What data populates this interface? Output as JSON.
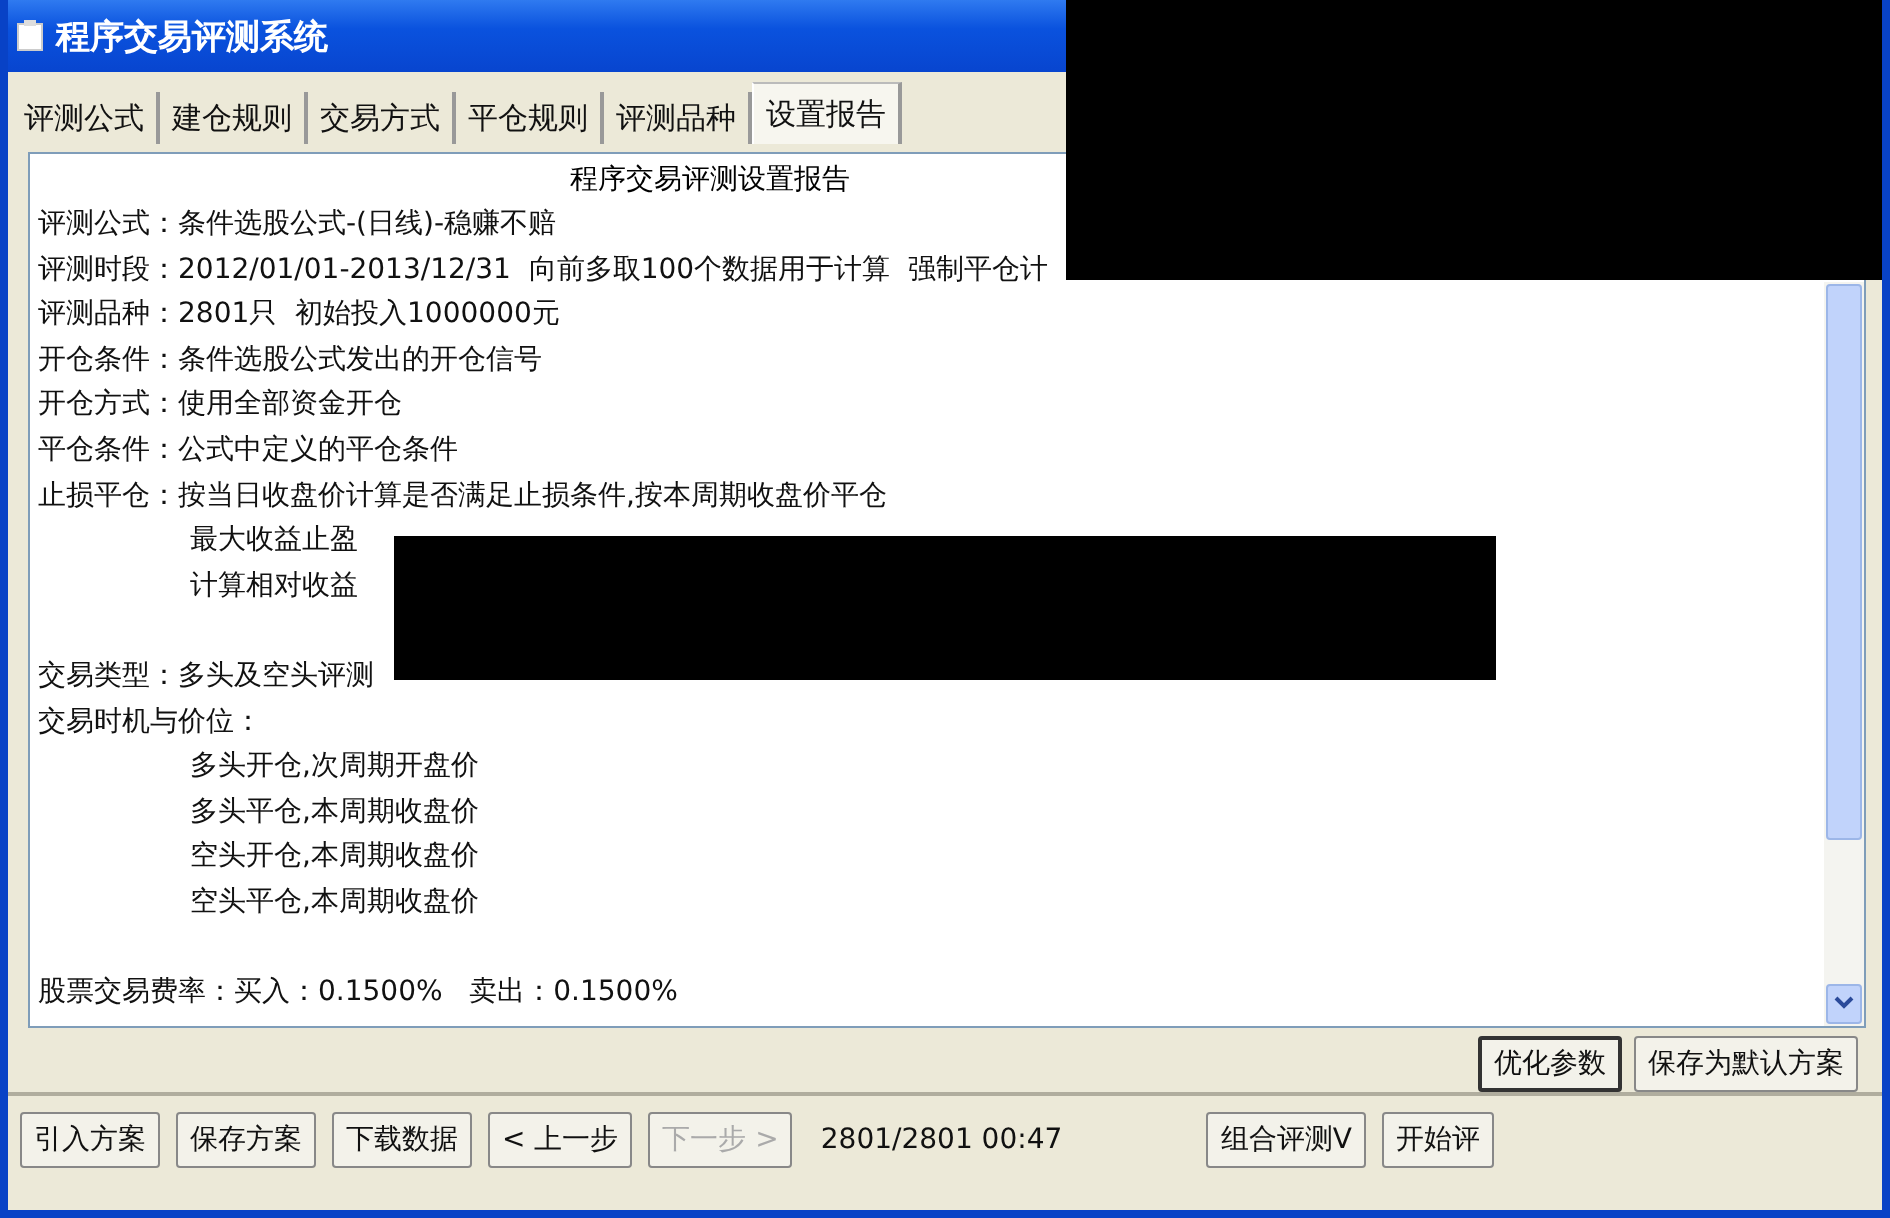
{
  "window": {
    "title": "程序交易评测系统"
  },
  "tabs": [
    {
      "label": "评测公式",
      "selected": false
    },
    {
      "label": "建仓规则",
      "selected": false
    },
    {
      "label": "交易方式",
      "selected": false
    },
    {
      "label": "平仓规则",
      "selected": false
    },
    {
      "label": "评测品种",
      "selected": false
    },
    {
      "label": "设置报告",
      "selected": true
    }
  ],
  "report": {
    "title": "程序交易评测设置报告",
    "lines": [
      {
        "kind": "field",
        "text": "评测公式：条件选股公式-(日线)-稳赚不赔"
      },
      {
        "kind": "field",
        "text": "评测时段：2012/01/01-2013/12/31  向前多取100个数据用于计算  强制平仓计"
      },
      {
        "kind": "field",
        "text": "评测品种：2801只  初始投入1000000元"
      },
      {
        "kind": "field",
        "text": "开仓条件：条件选股公式发出的开仓信号"
      },
      {
        "kind": "field",
        "text": "开仓方式：使用全部资金开仓"
      },
      {
        "kind": "field",
        "text": "平仓条件：公式中定义的平仓条件"
      },
      {
        "kind": "field",
        "text": "止损平仓：按当日收盘价计算是否满足止损条件,按本周期收盘价平仓"
      },
      {
        "kind": "indent",
        "text": "最大收益止盈"
      },
      {
        "kind": "indent",
        "text": "计算相对收益"
      },
      {
        "kind": "blank"
      },
      {
        "kind": "field",
        "text": "交易类型：多头及空头评测"
      },
      {
        "kind": "field",
        "text": "交易时机与价位："
      },
      {
        "kind": "indent",
        "text": "多头开仓,次周期开盘价"
      },
      {
        "kind": "indent",
        "text": "多头平仓,本周期收盘价"
      },
      {
        "kind": "indent",
        "text": "空头开仓,本周期收盘价"
      },
      {
        "kind": "indent",
        "text": "空头平仓,本周期收盘价"
      },
      {
        "kind": "blank"
      },
      {
        "kind": "field",
        "text": "股票交易费率：买入：0.1500%   卖出：0.1500%"
      }
    ]
  },
  "option_buttons": [
    {
      "label": "优化参数",
      "focused": true
    },
    {
      "label": "保存为默认方案",
      "focused": false
    }
  ],
  "toolbar": [
    {
      "kind": "button",
      "label": "引入方案",
      "disabled": false
    },
    {
      "kind": "button",
      "label": "保存方案",
      "disabled": false
    },
    {
      "kind": "button",
      "label": "下载数据",
      "disabled": false
    },
    {
      "kind": "button",
      "label": "< 上一步",
      "disabled": false
    },
    {
      "kind": "button",
      "label": "下一步 >",
      "disabled": true
    },
    {
      "kind": "status",
      "label": "2801/2801 00:47"
    },
    {
      "kind": "spacer"
    },
    {
      "kind": "button",
      "label": "组合评测V",
      "disabled": false
    },
    {
      "kind": "button",
      "label": "开始评",
      "disabled": false
    }
  ]
}
